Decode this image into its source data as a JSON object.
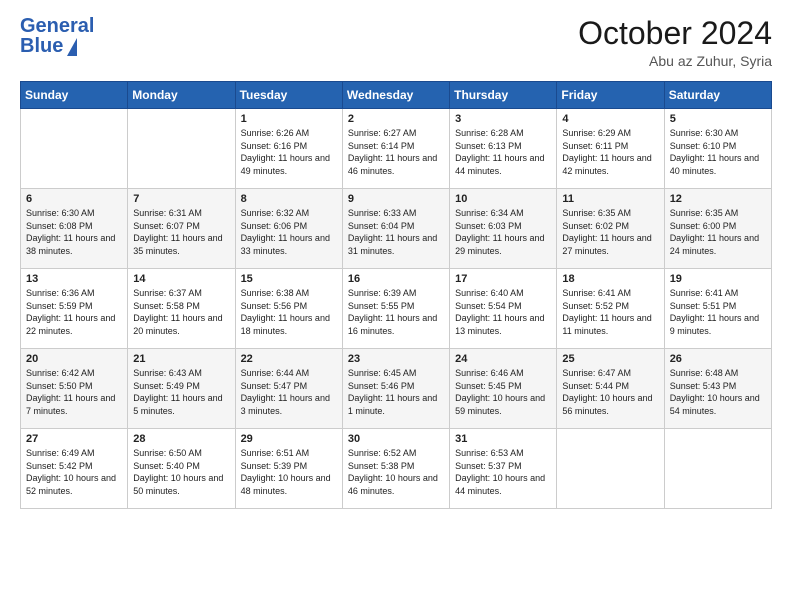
{
  "header": {
    "logo_line1": "General",
    "logo_line2": "Blue",
    "month_title": "October 2024",
    "location": "Abu az Zuhur, Syria"
  },
  "days_of_week": [
    "Sunday",
    "Monday",
    "Tuesday",
    "Wednesday",
    "Thursday",
    "Friday",
    "Saturday"
  ],
  "weeks": [
    [
      {
        "day": "",
        "content": ""
      },
      {
        "day": "",
        "content": ""
      },
      {
        "day": "1",
        "content": "Sunrise: 6:26 AM\nSunset: 6:16 PM\nDaylight: 11 hours and 49 minutes."
      },
      {
        "day": "2",
        "content": "Sunrise: 6:27 AM\nSunset: 6:14 PM\nDaylight: 11 hours and 46 minutes."
      },
      {
        "day": "3",
        "content": "Sunrise: 6:28 AM\nSunset: 6:13 PM\nDaylight: 11 hours and 44 minutes."
      },
      {
        "day": "4",
        "content": "Sunrise: 6:29 AM\nSunset: 6:11 PM\nDaylight: 11 hours and 42 minutes."
      },
      {
        "day": "5",
        "content": "Sunrise: 6:30 AM\nSunset: 6:10 PM\nDaylight: 11 hours and 40 minutes."
      }
    ],
    [
      {
        "day": "6",
        "content": "Sunrise: 6:30 AM\nSunset: 6:08 PM\nDaylight: 11 hours and 38 minutes."
      },
      {
        "day": "7",
        "content": "Sunrise: 6:31 AM\nSunset: 6:07 PM\nDaylight: 11 hours and 35 minutes."
      },
      {
        "day": "8",
        "content": "Sunrise: 6:32 AM\nSunset: 6:06 PM\nDaylight: 11 hours and 33 minutes."
      },
      {
        "day": "9",
        "content": "Sunrise: 6:33 AM\nSunset: 6:04 PM\nDaylight: 11 hours and 31 minutes."
      },
      {
        "day": "10",
        "content": "Sunrise: 6:34 AM\nSunset: 6:03 PM\nDaylight: 11 hours and 29 minutes."
      },
      {
        "day": "11",
        "content": "Sunrise: 6:35 AM\nSunset: 6:02 PM\nDaylight: 11 hours and 27 minutes."
      },
      {
        "day": "12",
        "content": "Sunrise: 6:35 AM\nSunset: 6:00 PM\nDaylight: 11 hours and 24 minutes."
      }
    ],
    [
      {
        "day": "13",
        "content": "Sunrise: 6:36 AM\nSunset: 5:59 PM\nDaylight: 11 hours and 22 minutes."
      },
      {
        "day": "14",
        "content": "Sunrise: 6:37 AM\nSunset: 5:58 PM\nDaylight: 11 hours and 20 minutes."
      },
      {
        "day": "15",
        "content": "Sunrise: 6:38 AM\nSunset: 5:56 PM\nDaylight: 11 hours and 18 minutes."
      },
      {
        "day": "16",
        "content": "Sunrise: 6:39 AM\nSunset: 5:55 PM\nDaylight: 11 hours and 16 minutes."
      },
      {
        "day": "17",
        "content": "Sunrise: 6:40 AM\nSunset: 5:54 PM\nDaylight: 11 hours and 13 minutes."
      },
      {
        "day": "18",
        "content": "Sunrise: 6:41 AM\nSunset: 5:52 PM\nDaylight: 11 hours and 11 minutes."
      },
      {
        "day": "19",
        "content": "Sunrise: 6:41 AM\nSunset: 5:51 PM\nDaylight: 11 hours and 9 minutes."
      }
    ],
    [
      {
        "day": "20",
        "content": "Sunrise: 6:42 AM\nSunset: 5:50 PM\nDaylight: 11 hours and 7 minutes."
      },
      {
        "day": "21",
        "content": "Sunrise: 6:43 AM\nSunset: 5:49 PM\nDaylight: 11 hours and 5 minutes."
      },
      {
        "day": "22",
        "content": "Sunrise: 6:44 AM\nSunset: 5:47 PM\nDaylight: 11 hours and 3 minutes."
      },
      {
        "day": "23",
        "content": "Sunrise: 6:45 AM\nSunset: 5:46 PM\nDaylight: 11 hours and 1 minute."
      },
      {
        "day": "24",
        "content": "Sunrise: 6:46 AM\nSunset: 5:45 PM\nDaylight: 10 hours and 59 minutes."
      },
      {
        "day": "25",
        "content": "Sunrise: 6:47 AM\nSunset: 5:44 PM\nDaylight: 10 hours and 56 minutes."
      },
      {
        "day": "26",
        "content": "Sunrise: 6:48 AM\nSunset: 5:43 PM\nDaylight: 10 hours and 54 minutes."
      }
    ],
    [
      {
        "day": "27",
        "content": "Sunrise: 6:49 AM\nSunset: 5:42 PM\nDaylight: 10 hours and 52 minutes."
      },
      {
        "day": "28",
        "content": "Sunrise: 6:50 AM\nSunset: 5:40 PM\nDaylight: 10 hours and 50 minutes."
      },
      {
        "day": "29",
        "content": "Sunrise: 6:51 AM\nSunset: 5:39 PM\nDaylight: 10 hours and 48 minutes."
      },
      {
        "day": "30",
        "content": "Sunrise: 6:52 AM\nSunset: 5:38 PM\nDaylight: 10 hours and 46 minutes."
      },
      {
        "day": "31",
        "content": "Sunrise: 6:53 AM\nSunset: 5:37 PM\nDaylight: 10 hours and 44 minutes."
      },
      {
        "day": "",
        "content": ""
      },
      {
        "day": "",
        "content": ""
      }
    ]
  ]
}
